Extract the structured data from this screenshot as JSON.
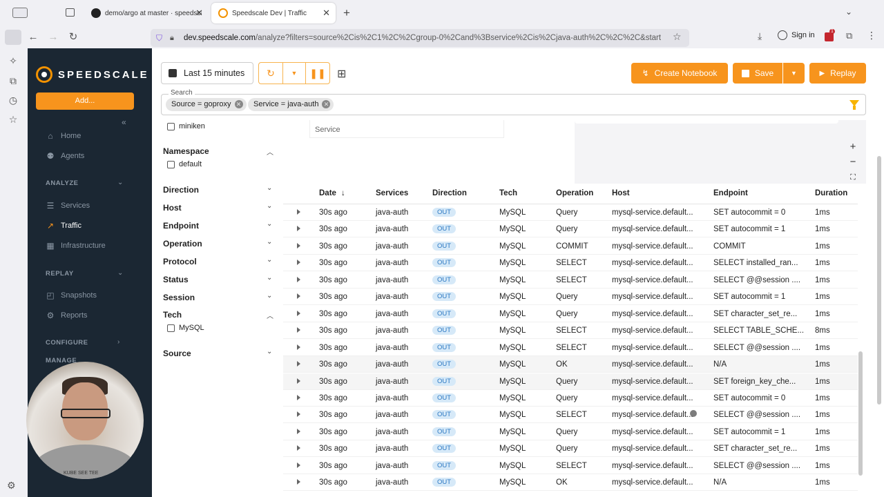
{
  "browser": {
    "tabs": [
      {
        "title": "demo/argo at master · speedscale/...",
        "active": false
      },
      {
        "title": "Speedscale Dev | Traffic",
        "active": true
      }
    ],
    "url_host": "dev.speedscale.com",
    "url_path": "/analyze?filters=source%2Cis%2C1%2C%2Cgroup-0%2Cand%3Bservice%2Cis%2Cjava-auth%2C%2C%2C&start",
    "signin_label": "Sign in",
    "badge_count": "1"
  },
  "sidebar": {
    "brand": "SPEEDSCALE",
    "add_label": "Add...",
    "home": "Home",
    "agents": "Agents",
    "analyze_section": "ANALYZE",
    "services": "Services",
    "traffic": "Traffic",
    "infrastructure": "Infrastructure",
    "replay_section": "REPLAY",
    "snapshots": "Snapshots",
    "reports": "Reports",
    "configure_section": "CONFIGURE",
    "manage_section": "MANAGE",
    "webcam_shirt_text": "KUBE SEE TEE"
  },
  "toolbar": {
    "time_range": "Last 15 minutes",
    "create_notebook": "Create Notebook",
    "save": "Save",
    "replay": "Replay"
  },
  "search": {
    "label": "Search",
    "chips": [
      "Source = goproxy",
      "Service = java-auth"
    ]
  },
  "filters": {
    "top_option": "miniken",
    "namespace": "Namespace",
    "namespace_option": "default",
    "direction": "Direction",
    "host": "Host",
    "endpoint": "Endpoint",
    "operation": "Operation",
    "protocol": "Protocol",
    "status": "Status",
    "session": "Session",
    "tech": "Tech",
    "tech_option": "MySQL",
    "source": "Source"
  },
  "map": {
    "service_label": "Service",
    "zoom_in": "+",
    "zoom_out": "−"
  },
  "table": {
    "headers": [
      "Date",
      "Services",
      "Direction",
      "Tech",
      "Operation",
      "Host",
      "Endpoint",
      "Duration"
    ],
    "rows": [
      [
        "30s ago",
        "java-auth",
        "OUT",
        "MySQL",
        "Query",
        "mysql-service.default...",
        "SET autocommit = 0",
        "1ms"
      ],
      [
        "30s ago",
        "java-auth",
        "OUT",
        "MySQL",
        "Query",
        "mysql-service.default...",
        "SET autocommit = 1",
        "1ms"
      ],
      [
        "30s ago",
        "java-auth",
        "OUT",
        "MySQL",
        "COMMIT",
        "mysql-service.default...",
        "COMMIT",
        "1ms"
      ],
      [
        "30s ago",
        "java-auth",
        "OUT",
        "MySQL",
        "SELECT",
        "mysql-service.default...",
        "SELECT installed_ran...",
        "1ms"
      ],
      [
        "30s ago",
        "java-auth",
        "OUT",
        "MySQL",
        "SELECT",
        "mysql-service.default...",
        "SELECT @@session ....",
        "1ms"
      ],
      [
        "30s ago",
        "java-auth",
        "OUT",
        "MySQL",
        "Query",
        "mysql-service.default...",
        "SET autocommit = 1",
        "1ms"
      ],
      [
        "30s ago",
        "java-auth",
        "OUT",
        "MySQL",
        "Query",
        "mysql-service.default...",
        "SET character_set_re...",
        "1ms"
      ],
      [
        "30s ago",
        "java-auth",
        "OUT",
        "MySQL",
        "SELECT",
        "mysql-service.default...",
        "SELECT TABLE_SCHE...",
        "8ms"
      ],
      [
        "30s ago",
        "java-auth",
        "OUT",
        "MySQL",
        "SELECT",
        "mysql-service.default...",
        "SELECT @@session ....",
        "1ms"
      ],
      [
        "30s ago",
        "java-auth",
        "OUT",
        "MySQL",
        "OK",
        "mysql-service.default...",
        "N/A",
        "1ms"
      ],
      [
        "30s ago",
        "java-auth",
        "OUT",
        "MySQL",
        "Query",
        "mysql-service.default...",
        "SET foreign_key_che...",
        "1ms"
      ],
      [
        "30s ago",
        "java-auth",
        "OUT",
        "MySQL",
        "Query",
        "mysql-service.default...",
        "SET autocommit = 0",
        "1ms"
      ],
      [
        "30s ago",
        "java-auth",
        "OUT",
        "MySQL",
        "SELECT",
        "mysql-service.default...",
        "SELECT @@session ....",
        "1ms"
      ],
      [
        "30s ago",
        "java-auth",
        "OUT",
        "MySQL",
        "Query",
        "mysql-service.default...",
        "SET autocommit = 1",
        "1ms"
      ],
      [
        "30s ago",
        "java-auth",
        "OUT",
        "MySQL",
        "Query",
        "mysql-service.default...",
        "SET character_set_re...",
        "1ms"
      ],
      [
        "30s ago",
        "java-auth",
        "OUT",
        "MySQL",
        "SELECT",
        "mysql-service.default...",
        "SELECT @@session ....",
        "1ms"
      ],
      [
        "30s ago",
        "java-auth",
        "OUT",
        "MySQL",
        "OK",
        "mysql-service.default...",
        "N/A",
        "1ms"
      ]
    ]
  },
  "colors": {
    "accent": "#f7941d",
    "sidebar_bg": "#1b2733",
    "badge_bg": "#d6e9f8",
    "badge_text": "#2b78c2"
  }
}
